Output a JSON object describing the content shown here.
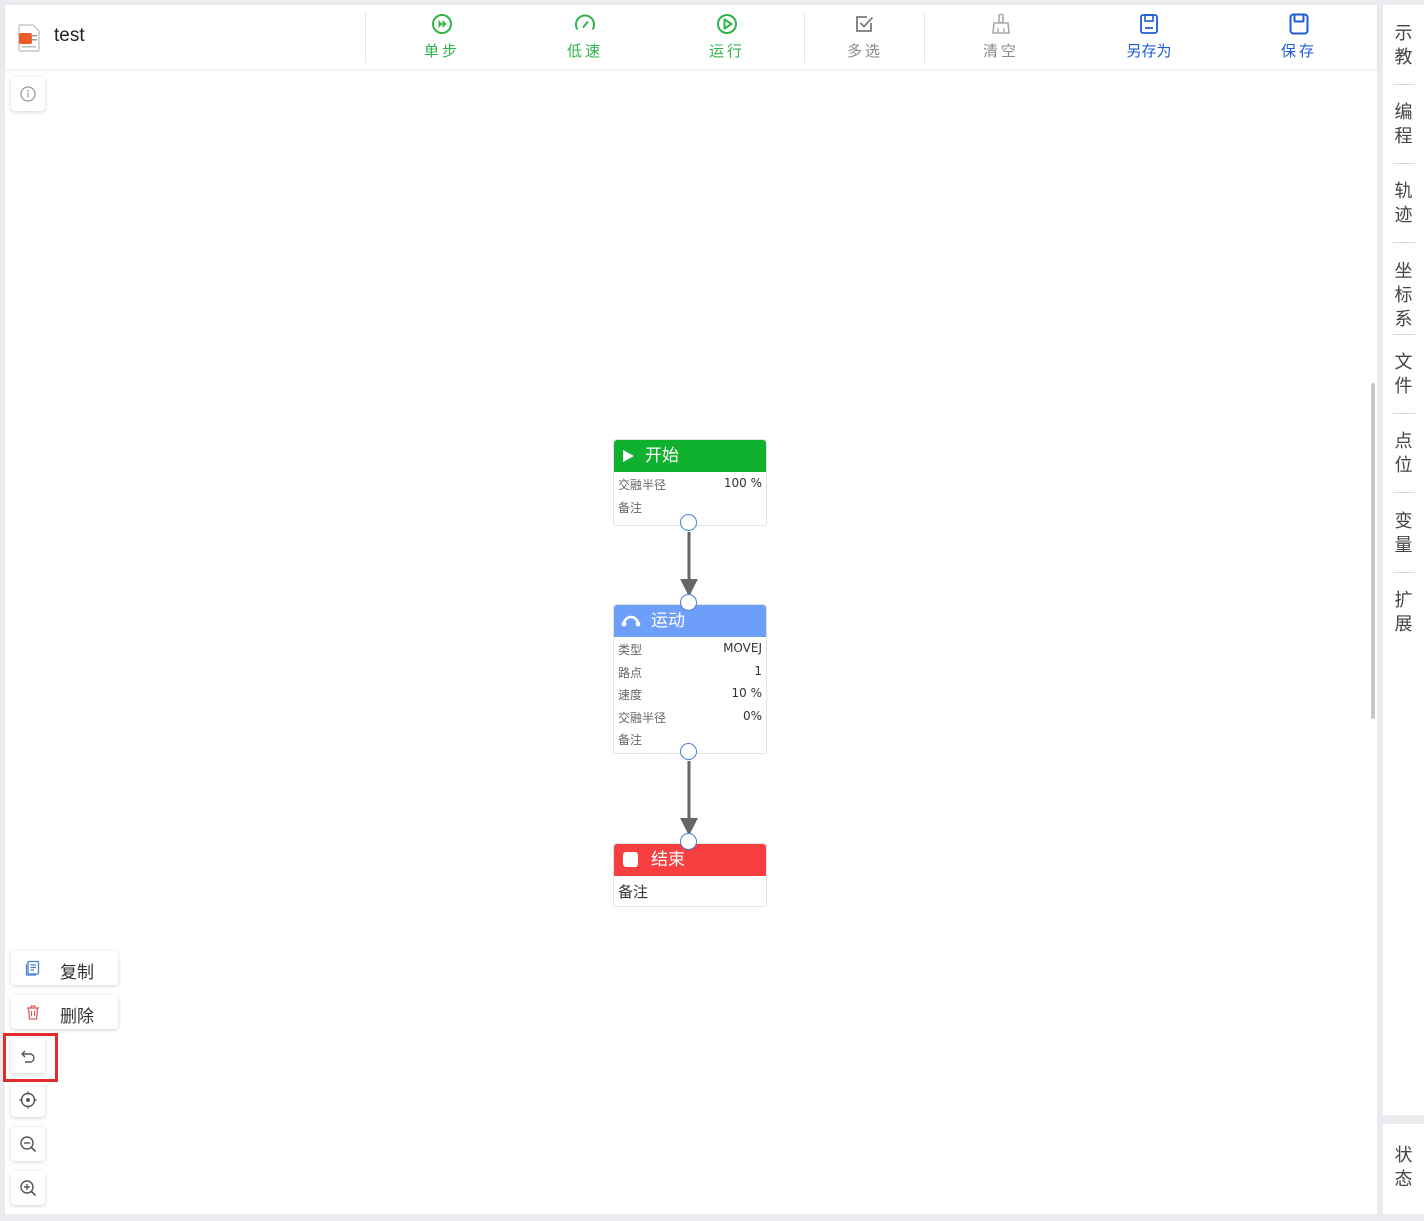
{
  "app": {
    "title": "test"
  },
  "toolbar": {
    "step": "单步",
    "low_speed": "低速",
    "run": "运行",
    "multi_select": "多选",
    "clear": "清空",
    "save_as": "另存为",
    "save": "保存"
  },
  "right_panel": {
    "items": [
      "示教",
      "编程",
      "轨迹",
      "坐标系",
      "文件",
      "点位",
      "变量",
      "扩展"
    ],
    "status": "状态"
  },
  "flow": {
    "start": {
      "title": "开始",
      "rows": [
        {
          "key": "交融半径",
          "value": "100 %"
        },
        {
          "key": "备注",
          "value": ""
        }
      ]
    },
    "motion": {
      "title": "运动",
      "rows": [
        {
          "key": "类型",
          "value": "MOVEJ"
        },
        {
          "key": "路点",
          "value": "1"
        },
        {
          "key": "速度",
          "value": "10 %"
        },
        {
          "key": "交融半径",
          "value": "0%"
        },
        {
          "key": "备注",
          "value": ""
        }
      ]
    },
    "end": {
      "title": "结束",
      "note_label": "备注"
    }
  },
  "side_actions": {
    "copy": "复制",
    "delete": "删除"
  },
  "colors": {
    "start_header": "#10b12f",
    "motion_header": "#6d9ffa",
    "end_header": "#f83f3f",
    "highlight": "#e32b2b"
  }
}
